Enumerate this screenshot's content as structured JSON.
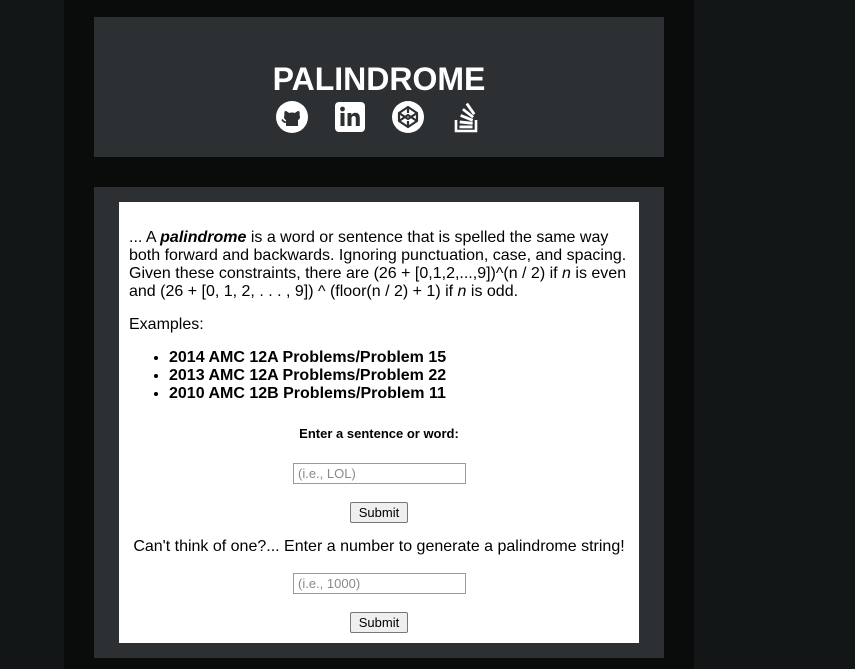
{
  "header": {
    "title": "PALINDROME",
    "social_links": [
      {
        "icon": "github-icon"
      },
      {
        "icon": "linkedin-icon"
      },
      {
        "icon": "codepen-icon"
      },
      {
        "icon": "stackoverflow-icon"
      }
    ]
  },
  "intro": {
    "prefix": "... A ",
    "term": "palindrome",
    "body_1": " is a word or sentence that is spelled the same way both forward and backwards. Ignoring punctuation, case, and spacing. Given these constraints, there are (26 + [0,1,2,...,9])^(n / 2) if ",
    "var_1": "n",
    "body_2": " is even and (26 + [0, 1, 2, . . . , 9]) ^ (floor(n / 2) + 1) if ",
    "var_2": "n",
    "body_3": " is odd."
  },
  "examples": {
    "label": "Examples:",
    "items": [
      "2014 AMC 12A Problems/Problem 15",
      "2013 AMC 12A Problems/Problem 22",
      "2010 AMC 12B Problems/Problem 11"
    ]
  },
  "word_form": {
    "label": "Enter a sentence or word:",
    "placeholder": "(i.e., LOL)",
    "submit": "Submit"
  },
  "number_form": {
    "label": "Can't think of one?... Enter a number to generate a palindrome string!",
    "placeholder": "(i.e., 1000)",
    "submit": "Submit"
  },
  "colors": {
    "page_background": "#121616",
    "column_background": "#0a0c0c",
    "card_background": "#2d3032",
    "content_background": "#ffffff",
    "title_color": "#ffffff"
  }
}
